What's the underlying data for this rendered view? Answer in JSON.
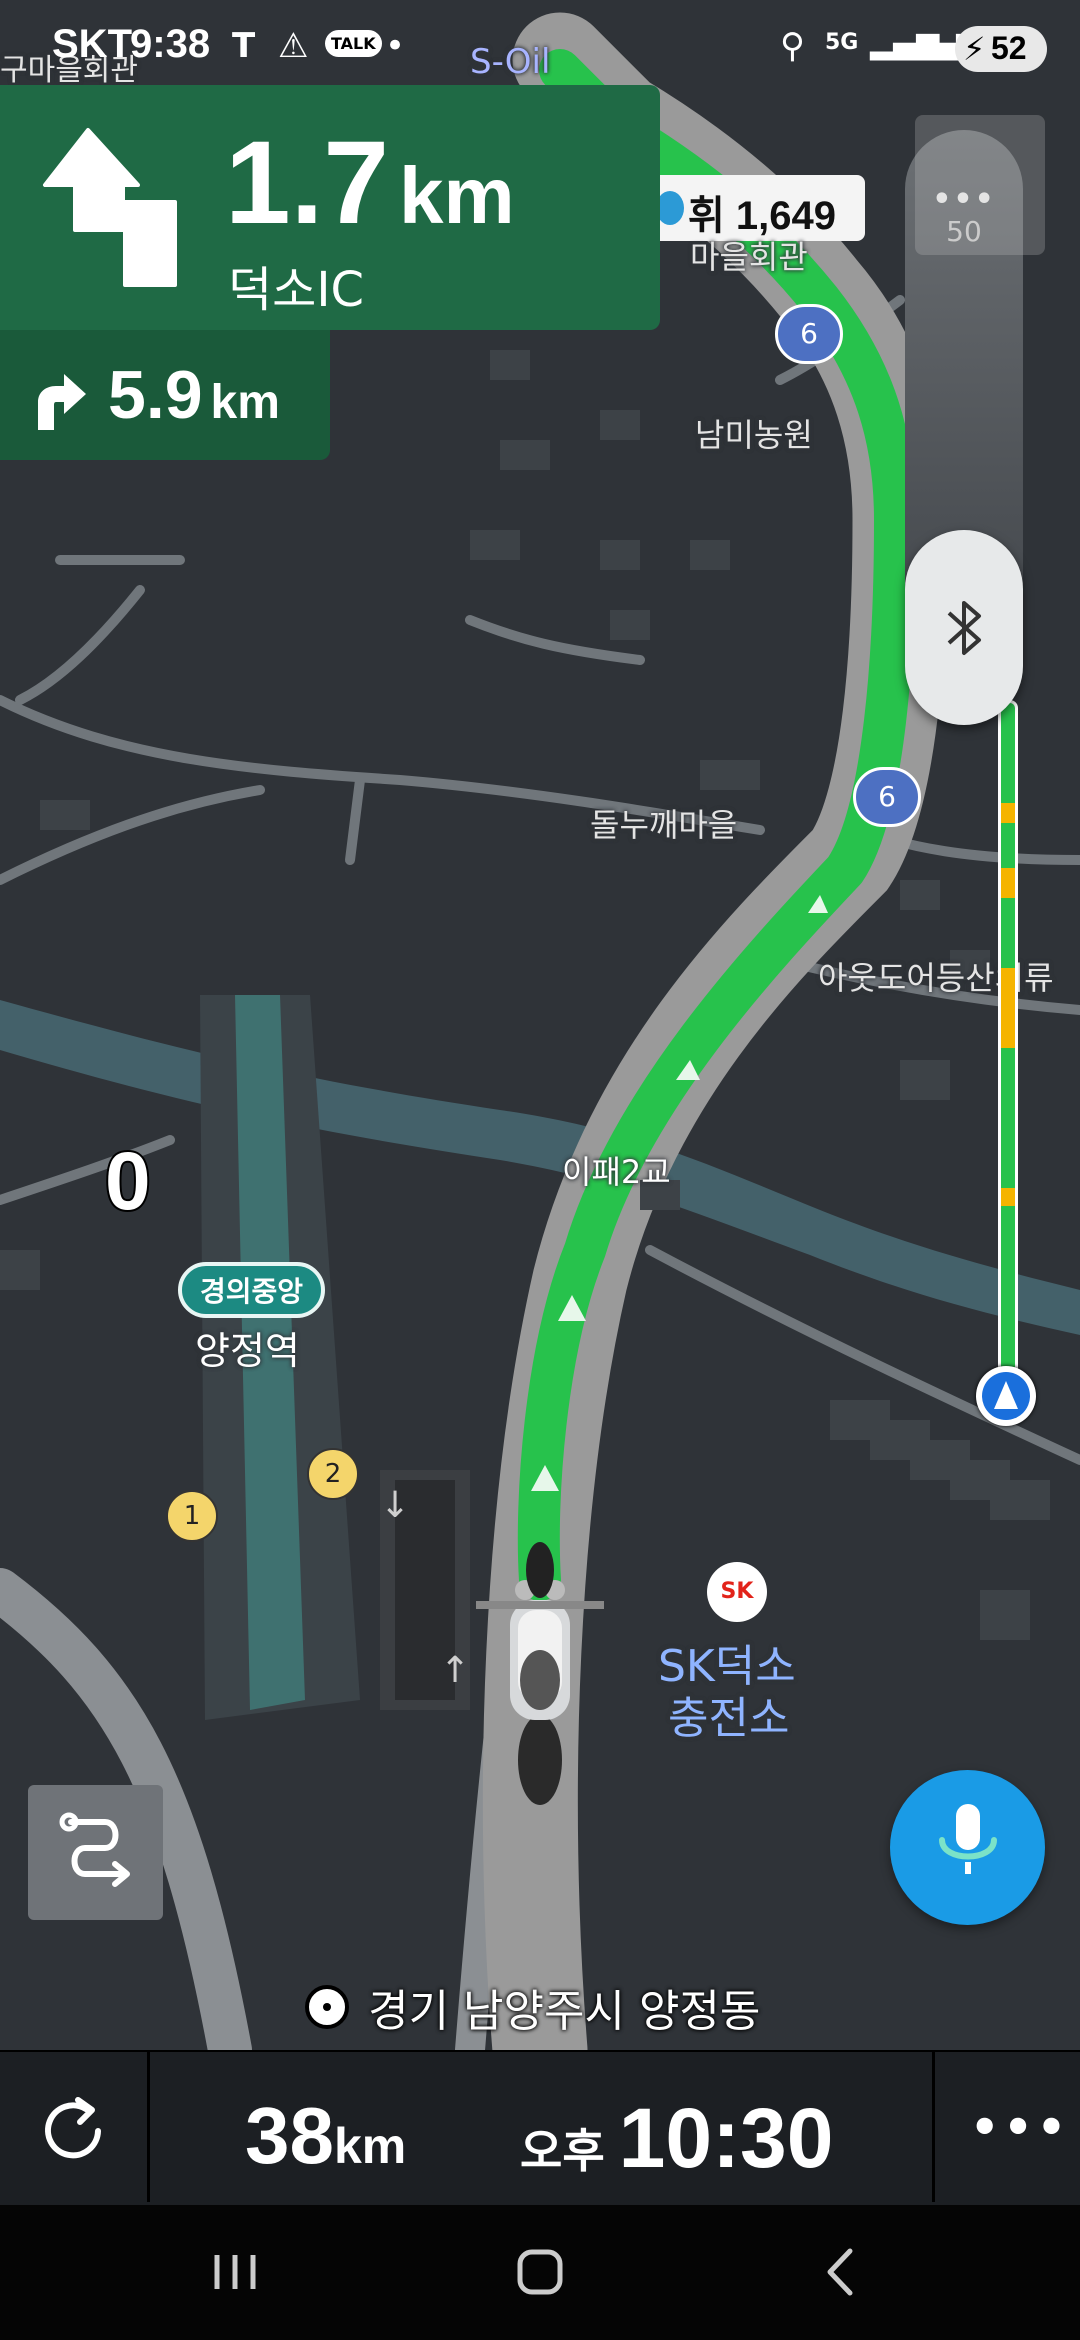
{
  "status_bar": {
    "carrier": "SKT",
    "time": "9:38",
    "battery": "52",
    "network": "5G"
  },
  "guidance": {
    "main_distance_value": "1.7",
    "main_distance_unit": "km",
    "main_destination": "덕소IC",
    "next_distance_value": "5.9",
    "next_distance_unit": "km"
  },
  "map": {
    "labels": {
      "top_left_partial": "구마을회관",
      "soil": "S-Oil",
      "gas_price": "휘 1,649",
      "hall": "마을회관",
      "farm": "남미농원",
      "village": "돌누깨마을",
      "outdoor": "아웃도어등산의류",
      "bridge": "이패2교",
      "line_badge": "경의중앙",
      "station": "양정역",
      "gas_station_line1": "SK덕소",
      "gas_station_line2": "충전소",
      "speed_zero": "0",
      "exit_1": "1",
      "exit_2": "2",
      "route_6_a": "6",
      "route_6_b": "6",
      "sk_logo": "SK"
    },
    "location_text": "경기 남양주시 양정동"
  },
  "gauge": {
    "speed_limit": "50"
  },
  "bottom": {
    "remaining_value": "38",
    "remaining_unit": "km",
    "arrival_period": "오후",
    "arrival_time": "10:30"
  },
  "colors": {
    "route": "#27c24c",
    "guidance_bg": "#1f6a45",
    "mic": "#1a9be6"
  }
}
